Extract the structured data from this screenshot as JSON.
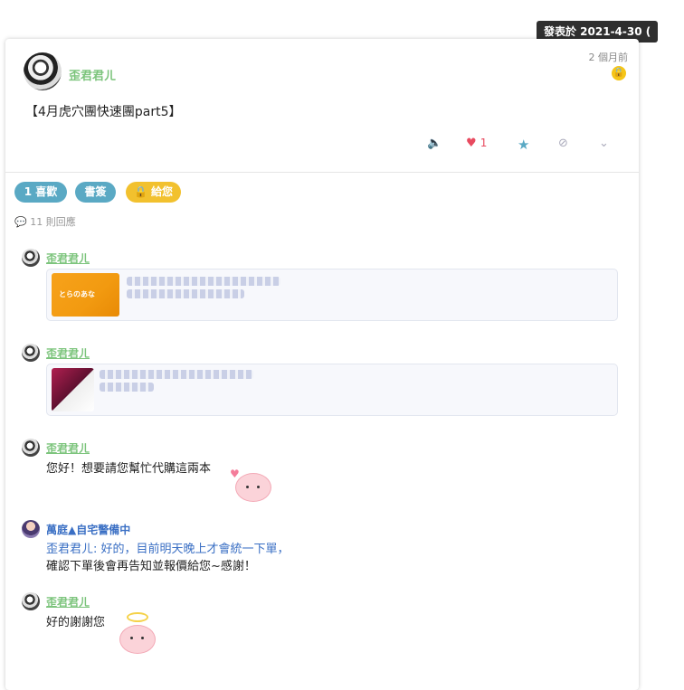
{
  "tooltip": {
    "text": "發表於 2021-4-30 ("
  },
  "post": {
    "author": "歪君君ㄦ",
    "time_ago": "2 個月前",
    "body": "【4月虎穴團快速團part5】",
    "like_count": "1",
    "icons": {
      "mute": "speaker-icon",
      "like": "heart-icon",
      "favorite": "star-icon",
      "block": "block-icon",
      "more": "chevron-down-icon",
      "lock": "lock-icon"
    }
  },
  "pills": {
    "likes": "1 喜歡",
    "bookmark": "書簽",
    "tip": "🔒 給您"
  },
  "replies": {
    "count_label": "11 則回應"
  },
  "comments": [
    {
      "author": "歪君君ㄦ",
      "thumb_text": "とらのあな"
    },
    {
      "author": "歪君君ㄦ"
    },
    {
      "author": "歪君君ㄦ",
      "text": "您好！想要請您幫忙代購這兩本"
    },
    {
      "author": "萬庭▲自宅警備中",
      "line1": "歪君君ㄦ: 好的，目前明天晚上才會統一下單，",
      "line2": "確認下單後會再告知並報價給您~感謝！"
    },
    {
      "author": "歪君君ㄦ",
      "text": "好的謝謝您"
    }
  ],
  "colors": {
    "green": "#7cc47c",
    "teal": "#5aa9c4",
    "yellow": "#f2c12e",
    "blue": "#3a6fc4",
    "heart": "#e84a5f"
  }
}
